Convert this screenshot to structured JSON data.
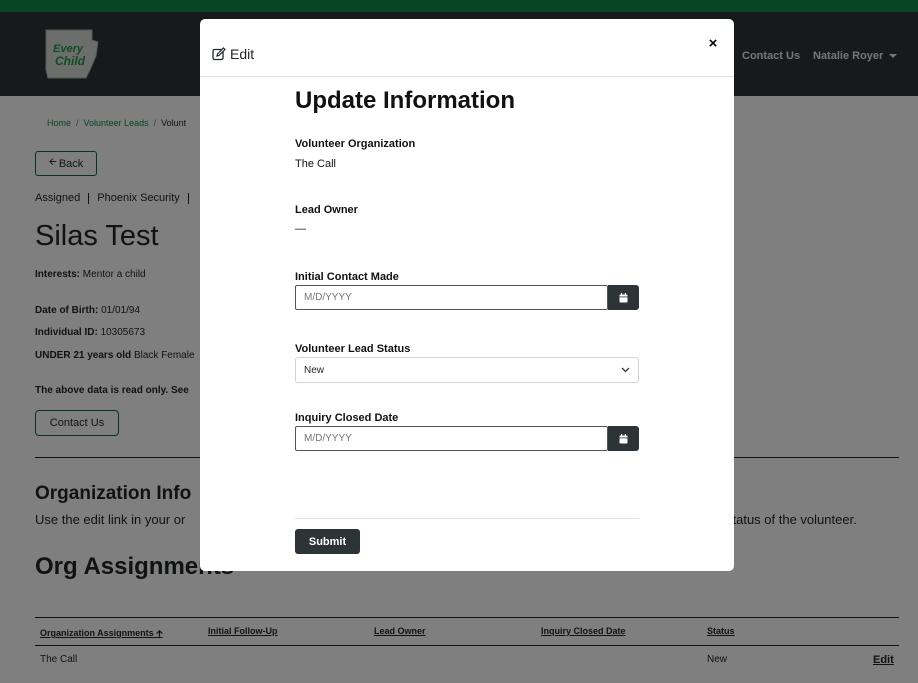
{
  "nav": {
    "logo_text": "Every Child",
    "contact": "Contact Us",
    "user": "Natalie Royer"
  },
  "breadcrumb": {
    "home": "Home",
    "volunteer_leads": "Volunteer Leads",
    "current": "Volunt"
  },
  "page": {
    "back": "Back",
    "tag1": "Assigned",
    "tag2": "Phoenix Security",
    "name": "Silas Test",
    "interests_label": "Interests:",
    "interests_value": "Mentor a child",
    "dob_label": "Date of Birth:",
    "dob_value": "01/01/94",
    "id_label": "Individual ID:",
    "id_value": "10305673",
    "age_label": "UNDER 21 years old",
    "age_value": "Black Female",
    "readonly": "The above data is read only. See",
    "contact_btn": "Contact Us",
    "org_info_title": "Organization Info",
    "org_info_desc": "Use the edit link in your or",
    "org_info_desc_end": "status of the volunteer.",
    "org_assign_title": "Org Assignments"
  },
  "table": {
    "headers": [
      "Organization Assignments",
      "Initial Follow-Up",
      "Lead Owner",
      "Inquiry Closed Date",
      "Status"
    ],
    "row": {
      "org": "The Call",
      "status": "New",
      "edit": "Edit"
    }
  },
  "modal": {
    "title": "Edit",
    "close": "×",
    "form_title": "Update Information",
    "vol_org_label": "Volunteer Organization",
    "vol_org_value": "The Call",
    "lead_owner_label": "Lead Owner",
    "lead_owner_value": "—",
    "initial_contact_label": "Initial Contact Made",
    "initial_contact_placeholder": "M/D/YYYY",
    "status_label": "Volunteer Lead Status",
    "status_value": "New",
    "closed_label": "Inquiry Closed Date",
    "closed_placeholder": "M/D/YYYY",
    "submit": "Submit"
  },
  "colors": {
    "brand_green": "#0f8a4a",
    "navbar": "#2c3438",
    "dark_button": "#2c3438"
  }
}
